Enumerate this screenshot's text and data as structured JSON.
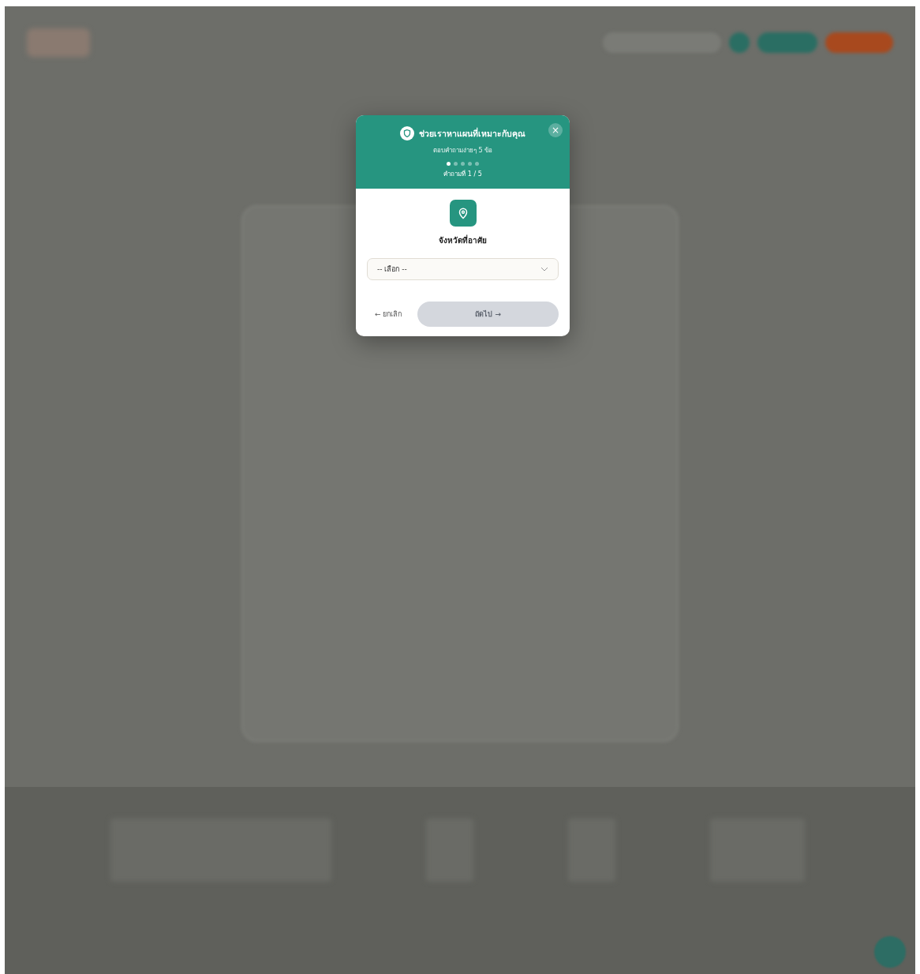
{
  "modal": {
    "title": "ช่วยเราหาแผนที่เหมาะกับคุณ",
    "subtitle": "ตอบคำถามง่ายๆ 5 ข้อ",
    "close": "×",
    "steps": [
      {
        "selected": true
      },
      {
        "selected": false
      },
      {
        "selected": false
      },
      {
        "selected": false
      },
      {
        "selected": false
      }
    ],
    "step_label": "คำถามที่ 1 / 5",
    "question": "จังหวัดที่อาศัย",
    "select": {
      "value": "-- เลือก --"
    },
    "cancel_button": "← ยกเลิก",
    "next_button": {
      "label": "ถัดไป →",
      "disabled": true
    }
  }
}
